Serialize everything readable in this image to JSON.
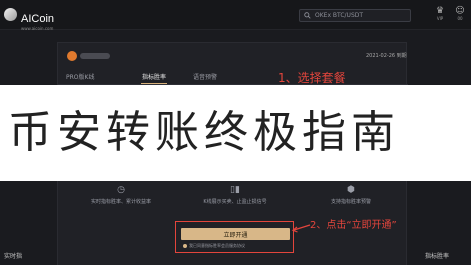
{
  "header": {
    "logo_name": "AICoin",
    "logo_url": "www.aicoin.com",
    "search_placeholder": "OKEx BTC/USDT",
    "vip_label": "VIP",
    "user_label": "00"
  },
  "modal": {
    "date": "2021-02-26 到期",
    "tabs": [
      {
        "label": "PRO版K线"
      },
      {
        "label": "指标胜率"
      },
      {
        "label": "语音预警"
      }
    ],
    "features": [
      {
        "icon": "clock-icon",
        "text": "实时指标胜率、累计收益率"
      },
      {
        "icon": "candlestick-icon",
        "text": "K线展示买卖、止盈止损信号"
      },
      {
        "icon": "hexagon-icon",
        "text": "支持指标胜率预警"
      }
    ],
    "open_button": "立即开通",
    "agreement": "我已同意指标胜率会员服务协议"
  },
  "annotations": {
    "step1": "1、选择套餐",
    "step2": "2、点击“立即开通”"
  },
  "banner": {
    "title": "币安转账终极指南"
  },
  "bottom": {
    "left": "实时指",
    "right": "指标胜率"
  },
  "colors": {
    "accent_gold": "#d8b788",
    "annotation_red": "#e3453c",
    "background": "#1a1b1f"
  }
}
